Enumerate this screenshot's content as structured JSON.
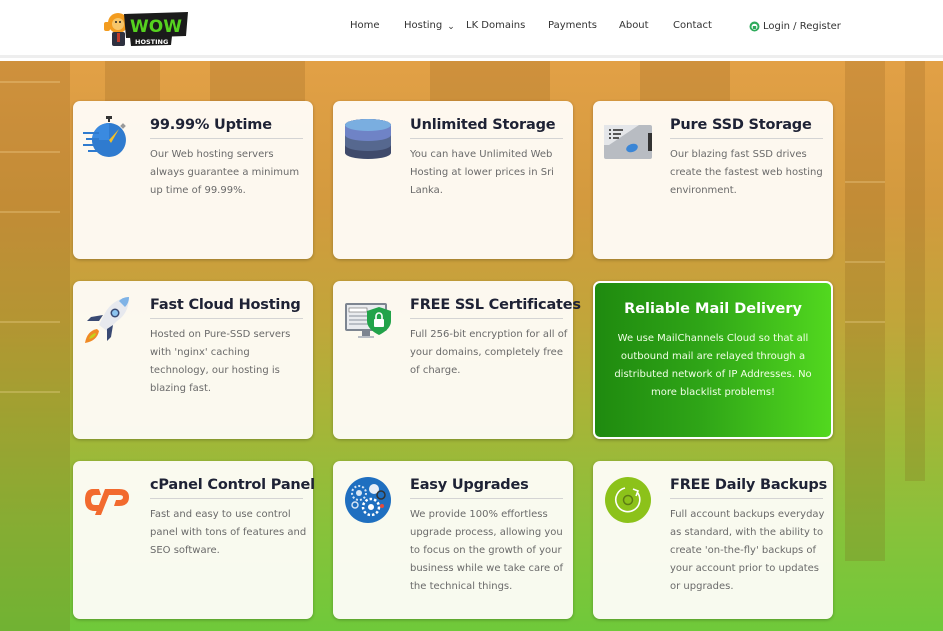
{
  "header": {
    "logo": {
      "text_top": "WOW",
      "text_bottom": "HOSTING",
      "alt": "WOW Hosting"
    },
    "nav": [
      {
        "label": "Home",
        "has_dropdown": false
      },
      {
        "label": "Hosting",
        "has_dropdown": true
      },
      {
        "label": "LK Domains",
        "has_dropdown": false
      },
      {
        "label": "Payments",
        "has_dropdown": false
      },
      {
        "label": "About",
        "has_dropdown": false
      },
      {
        "label": "Contact",
        "has_dropdown": false
      }
    ],
    "login": {
      "label": "Login / Register",
      "icon": "user-lock-icon"
    }
  },
  "features": [
    {
      "title": "99.99% Uptime",
      "desc": "Our Web hosting servers always guarantee a minimum up time of 99.99%.",
      "icon": "stopwatch-icon"
    },
    {
      "title": "Unlimited Storage",
      "desc": "You can have Unlimited Web Hosting at lower prices in Sri Lanka.",
      "icon": "database-icon"
    },
    {
      "title": "Pure SSD Storage",
      "desc": "Our blazing fast SSD drives create the fastest web hosting environment.",
      "icon": "ssd-drive-icon"
    },
    {
      "title": "Fast Cloud Hosting",
      "desc": "Hosted on Pure-SSD servers with 'nginx' caching technology, our hosting is blazing fast.",
      "icon": "rocket-icon"
    },
    {
      "title": "FREE SSL Certificates",
      "desc": "Full 256-bit encryption for all of your domains, completely free of charge.",
      "icon": "ssl-shield-icon"
    },
    {
      "title": "Reliable Mail Delivery",
      "desc": "We use MailChannels Cloud so that all outbound mail are relayed through a distributed network of IP Addresses. No more blacklist problems!",
      "icon": null,
      "highlight": true
    },
    {
      "title": "cPanel Control Panel",
      "desc": "Fast and easy to use control panel with tons of features and SEO software.",
      "icon": "cpanel-icon"
    },
    {
      "title": "Easy Upgrades",
      "desc": "We provide 100% effortless upgrade process, allowing you to focus on the growth of your business while we take care of the technical things.",
      "icon": "gears-icon"
    },
    {
      "title": "FREE Daily Backups",
      "desc": "Full account backups everyday as standard, with the ability to create 'on-the-fly' backups of your account prior to updates or upgrades.",
      "icon": "backup-icon"
    }
  ],
  "colors": {
    "highlight_green": "#2fa517",
    "title_text": "#1e2235",
    "body_text": "#6a6a6a",
    "cpanel_orange": "#f26a2e",
    "backup_green": "#8cc21a",
    "upgrade_blue": "#1f6fc0"
  }
}
